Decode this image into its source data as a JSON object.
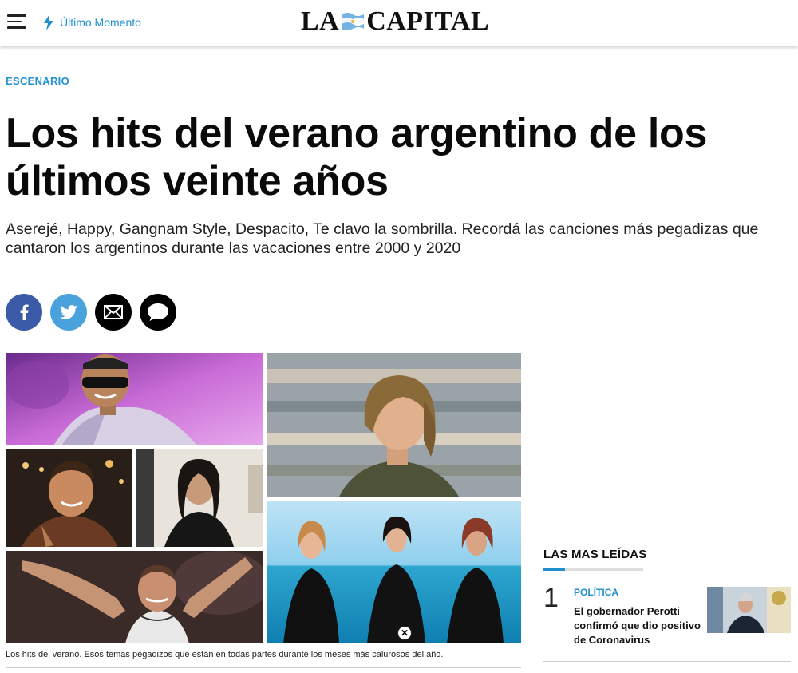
{
  "header": {
    "menu_icon": "hamburger-menu-icon",
    "ultimo_label": "Último Momento",
    "ultimo_icon": "lightning-bolt-icon",
    "logo_left": "LA",
    "logo_right": "CAPITAL",
    "accent": "#1f8fd0"
  },
  "article": {
    "section": "ESCENARIO",
    "title": "Los hits del verano argentino de los últimos veinte años",
    "lead": "Aserejé, Happy, Gangnam Style, Despacito, Te clavo la sombrilla. Recordá las canciones más pegadizas que cantaron los argentinos durante las vacaciones entre 2000 y 2020",
    "share": [
      {
        "name": "facebook",
        "icon": "facebook-icon",
        "color": "#3b5aa7"
      },
      {
        "name": "twitter",
        "icon": "twitter-icon",
        "color": "#4aa2dd"
      },
      {
        "name": "email",
        "icon": "envelope-icon",
        "color": "#000000"
      },
      {
        "name": "comments",
        "icon": "speech-bubble-icon",
        "color": "#000000"
      }
    ],
    "image_caption": "Los hits del verano. Esos temas pegadizos que están en todas partes durante los meses más calurosos del año.",
    "close_icon": "close-icon"
  },
  "sidebar": {
    "title": "LAS MAS LEÍDAS",
    "items": [
      {
        "rank": "1",
        "category": "POLÍTICA",
        "headline": "El gobernador Perotti confirmó que dio positivo de Coronavirus"
      }
    ]
  }
}
